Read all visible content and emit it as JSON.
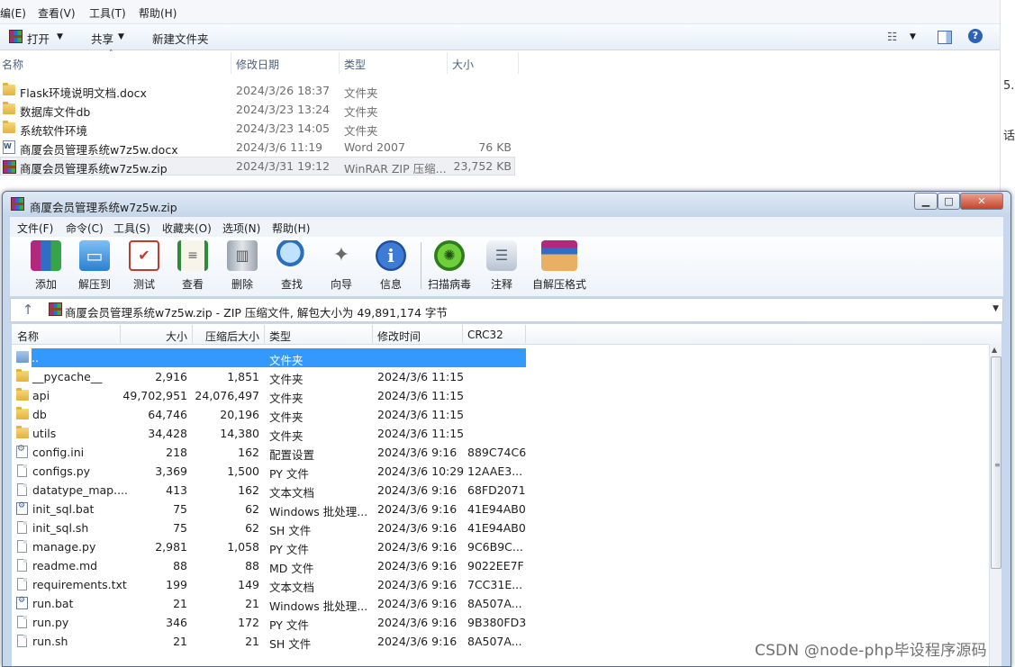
{
  "explorer": {
    "menu": [
      "编(E)",
      "查看(V)",
      "工具(T)",
      "帮助(H)"
    ],
    "toolbar": {
      "open": "打开",
      "share": "共享",
      "new_folder": "新建文件夹"
    },
    "columns": {
      "name": "名称",
      "date": "修改日期",
      "type": "类型",
      "size": "大小"
    },
    "rows": [
      {
        "name": "Flask环境说明文档.docx",
        "date": "2024/3/26 18:37",
        "type": "文件夹",
        "size": ""
      },
      {
        "name": "数据库文件db",
        "date": "2024/3/23 13:24",
        "type": "文件夹",
        "size": ""
      },
      {
        "name": "系统软件环境",
        "date": "2024/3/23 14:05",
        "type": "文件夹",
        "size": ""
      },
      {
        "name": "商厦会员管理系统w7z5w.docx",
        "date": "2024/3/6 11:19",
        "type": "Word 2007",
        "size": "76 KB"
      },
      {
        "name": "商厦会员管理系统w7z5w.zip",
        "date": "2024/3/31 19:12",
        "type": "WinRAR ZIP 压缩...",
        "size": "23,752 KB"
      }
    ]
  },
  "winrar": {
    "title": "商厦会员管理系统w7z5w.zip",
    "menu": [
      "文件(F)",
      "命令(C)",
      "工具(S)",
      "收藏夹(O)",
      "选项(N)",
      "帮助(H)"
    ],
    "tools": [
      "添加",
      "解压到",
      "测试",
      "查看",
      "删除",
      "查找",
      "向导",
      "信息",
      "扫描病毒",
      "注释",
      "自解压格式"
    ],
    "path": "商厦会员管理系统w7z5w.zip - ZIP 压缩文件, 解包大小为 49,891,174 字节",
    "columns": {
      "name": "名称",
      "size": "大小",
      "packed": "压缩后大小",
      "type": "类型",
      "modified": "修改时间",
      "crc": "CRC32"
    },
    "rows": [
      {
        "name": "..",
        "size": "",
        "packed": "",
        "type": "文件夹",
        "modified": "",
        "crc": ""
      },
      {
        "name": "__pycache__",
        "size": "2,916",
        "packed": "1,851",
        "type": "文件夹",
        "modified": "2024/3/6 11:15",
        "crc": ""
      },
      {
        "name": "api",
        "size": "49,702,951",
        "packed": "24,076,497",
        "type": "文件夹",
        "modified": "2024/3/6 11:15",
        "crc": ""
      },
      {
        "name": "db",
        "size": "64,746",
        "packed": "20,196",
        "type": "文件夹",
        "modified": "2024/3/6 11:15",
        "crc": ""
      },
      {
        "name": "utils",
        "size": "34,428",
        "packed": "14,380",
        "type": "文件夹",
        "modified": "2024/3/6 11:15",
        "crc": ""
      },
      {
        "name": "config.ini",
        "size": "218",
        "packed": "162",
        "type": "配置设置",
        "modified": "2024/3/6 9:16",
        "crc": "889C74C6"
      },
      {
        "name": "configs.py",
        "size": "3,369",
        "packed": "1,500",
        "type": "PY 文件",
        "modified": "2024/3/6 10:29",
        "crc": "12AAE3..."
      },
      {
        "name": "datatype_map....",
        "size": "413",
        "packed": "162",
        "type": "文本文档",
        "modified": "2024/3/6 9:16",
        "crc": "68FD2071"
      },
      {
        "name": "init_sql.bat",
        "size": "75",
        "packed": "62",
        "type": "Windows 批处理...",
        "modified": "2024/3/6 9:16",
        "crc": "41E94AB0"
      },
      {
        "name": "init_sql.sh",
        "size": "75",
        "packed": "62",
        "type": "SH 文件",
        "modified": "2024/3/6 9:16",
        "crc": "41E94AB0"
      },
      {
        "name": "manage.py",
        "size": "2,981",
        "packed": "1,058",
        "type": "PY 文件",
        "modified": "2024/3/6 9:16",
        "crc": "9C6B9C..."
      },
      {
        "name": "readme.md",
        "size": "88",
        "packed": "88",
        "type": "MD 文件",
        "modified": "2024/3/6 9:16",
        "crc": "9022EE7F"
      },
      {
        "name": "requirements.txt",
        "size": "199",
        "packed": "149",
        "type": "文本文档",
        "modified": "2024/3/6 9:16",
        "crc": "7CC31E..."
      },
      {
        "name": "run.bat",
        "size": "21",
        "packed": "21",
        "type": "Windows 批处理...",
        "modified": "2024/3/6 9:16",
        "crc": "8A507A..."
      },
      {
        "name": "run.py",
        "size": "346",
        "packed": "172",
        "type": "PY 文件",
        "modified": "2024/3/6 9:16",
        "crc": "9B380FD3"
      },
      {
        "name": "run.sh",
        "size": "21",
        "packed": "21",
        "type": "SH 文件",
        "modified": "2024/3/6 9:16",
        "crc": "8A507A..."
      }
    ]
  },
  "watermark": "CSDN @node-php毕设程序源码",
  "right_strip_glyphs": [
    "5.",
    "话"
  ],
  "colors": {
    "selection": "#3399ff",
    "title_bg": "#c5d6ea"
  }
}
